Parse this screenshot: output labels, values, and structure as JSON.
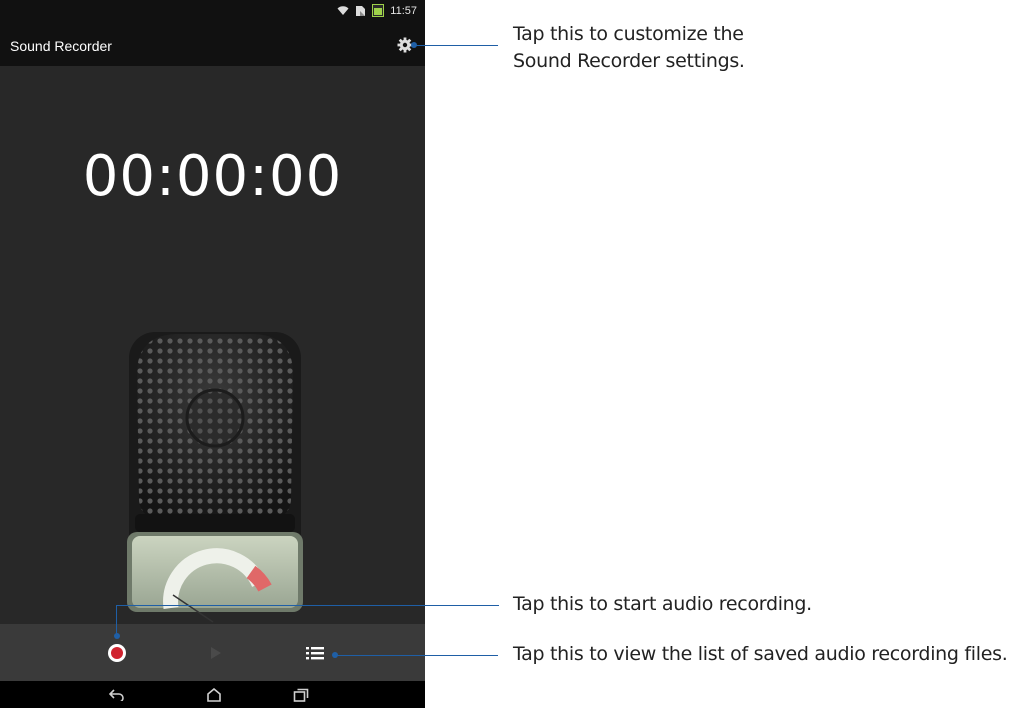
{
  "status_bar": {
    "time": "11:57"
  },
  "app_bar": {
    "title": "Sound Recorder",
    "settings_icon": "gear-icon"
  },
  "recorder": {
    "timer": "00:00:00"
  },
  "controls": {
    "record_icon": "record-icon",
    "play_icon": "play-icon",
    "list_icon": "list-icon"
  },
  "nav_bar": {
    "back_icon": "back-icon",
    "home_icon": "home-icon",
    "recents_icon": "recents-icon"
  },
  "callouts": {
    "settings": {
      "line1": "Tap this to customize the",
      "line2": "Sound Recorder settings."
    },
    "record": "Tap this to start audio recording.",
    "list": "Tap this to view the list of saved audio recording files."
  },
  "colors": {
    "callout_line": "#1f5fa6",
    "record_red": "#d0232f",
    "app_background": "#282828"
  }
}
